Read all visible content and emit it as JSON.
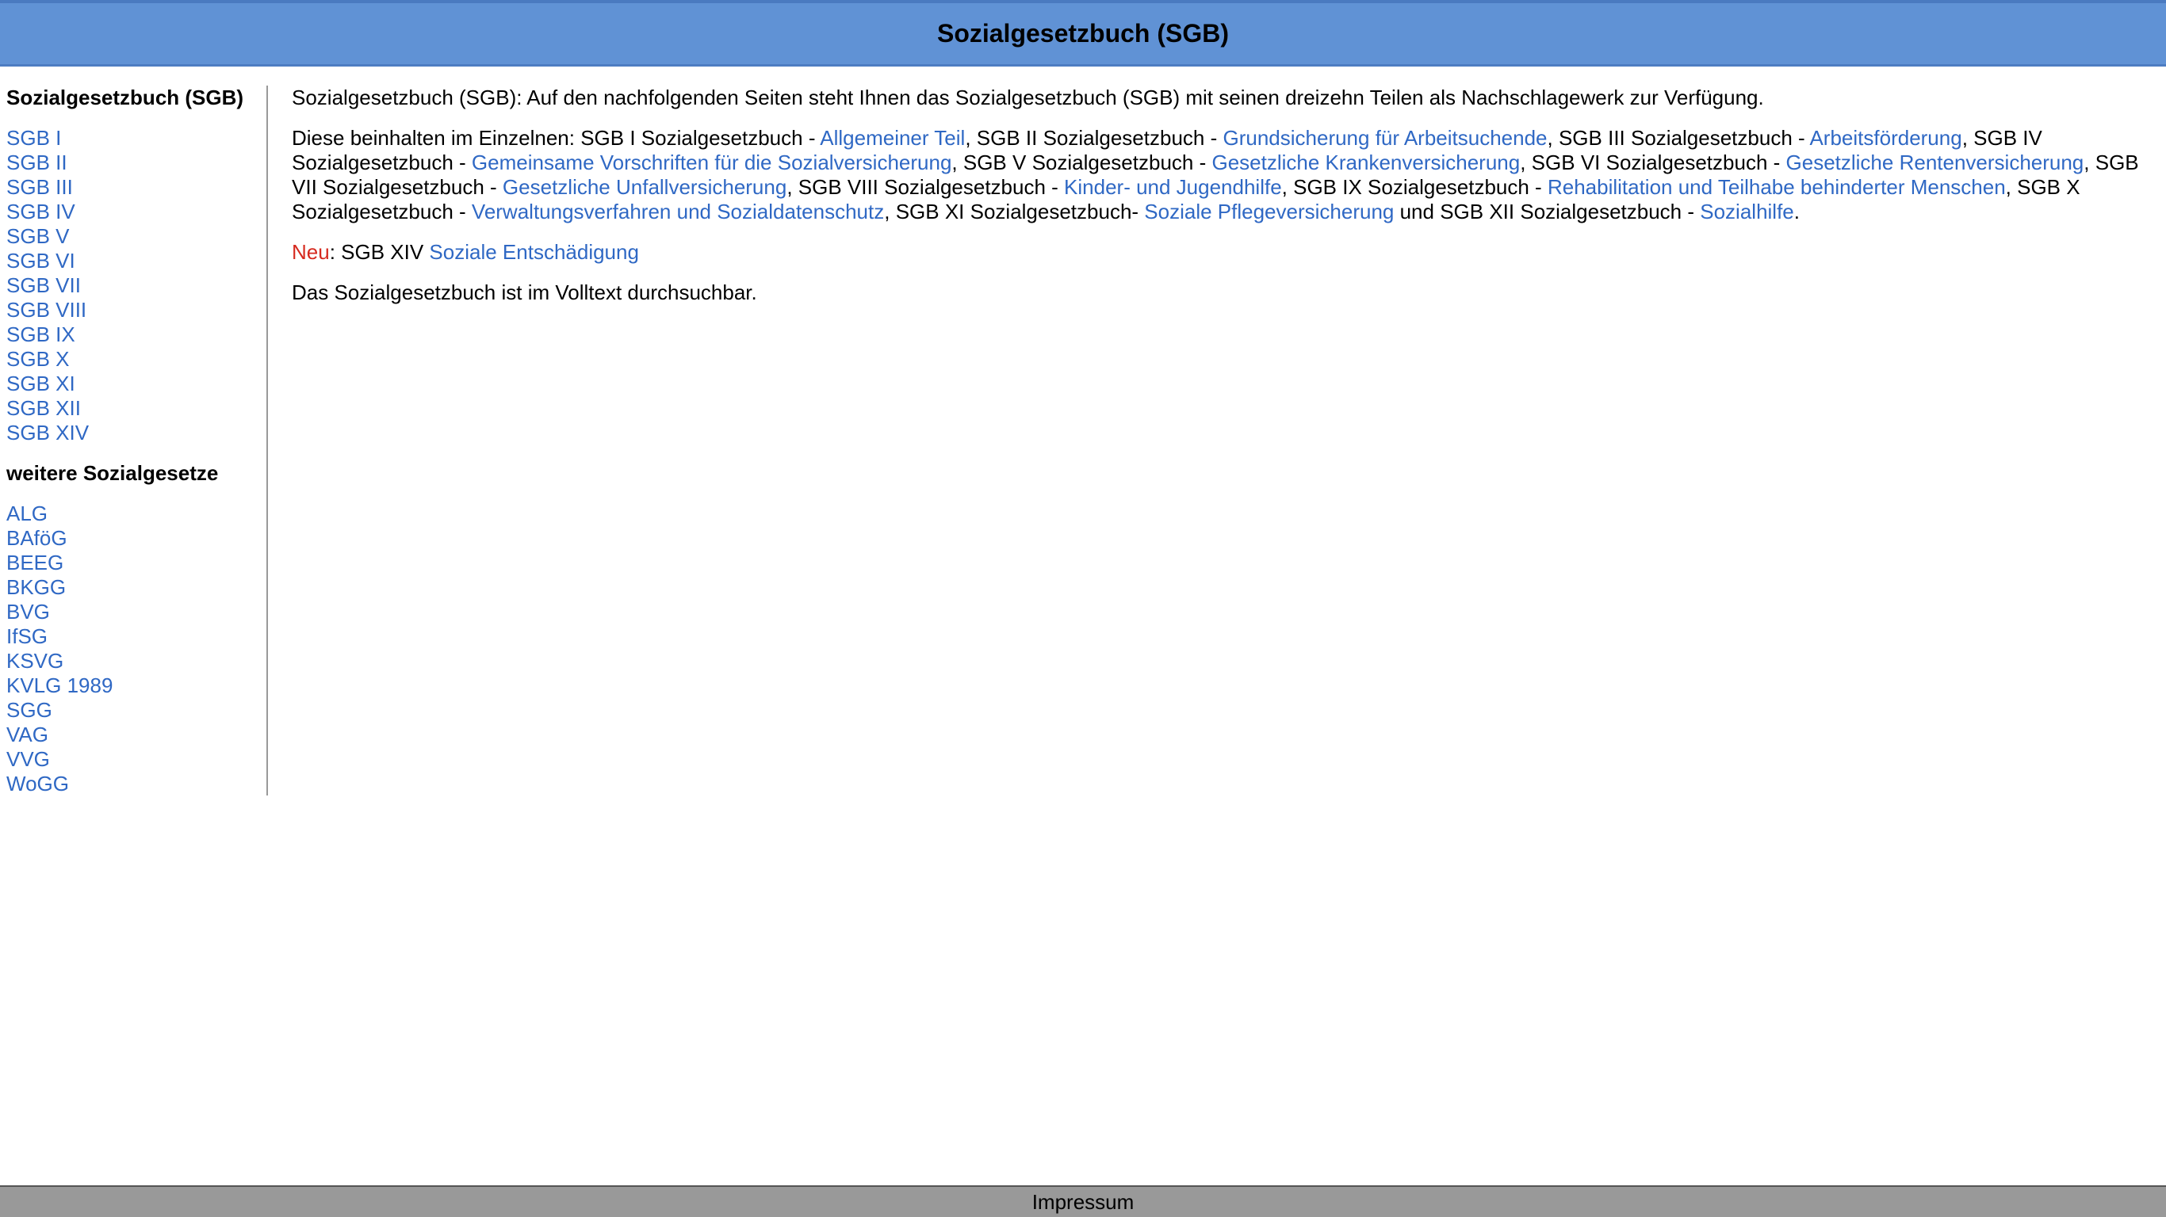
{
  "header": {
    "title": "Sozialgesetzbuch (SGB)"
  },
  "sidebar": {
    "heading_sgb": "Sozialgesetzbuch (SGB)",
    "sgb_links": [
      "SGB I",
      "SGB II",
      "SGB III",
      "SGB IV",
      "SGB V",
      "SGB VI",
      "SGB VII",
      "SGB VIII",
      "SGB IX",
      "SGB X",
      "SGB XI",
      "SGB XII",
      "SGB XIV"
    ],
    "heading_other": "weitere Sozialgesetze",
    "other_links": [
      "ALG",
      "BAföG",
      "BEEG",
      "BKGG",
      "BVG",
      "IfSG",
      "KSVG",
      "KVLG 1989",
      "SGG",
      "VAG",
      "VVG",
      "WoGG"
    ]
  },
  "main": {
    "intro": "Sozialgesetzbuch (SGB): Auf den nachfolgenden Seiten steht Ihnen das Sozialgesetzbuch (SGB) mit seinen dreizehn Teilen als Nachschlagewerk zur Verfügung.",
    "details": {
      "t0": "Diese beinhalten im Einzelnen: SGB I Sozialgesetzbuch - ",
      "l1": "Allgemeiner Teil",
      "t1": ", SGB II Sozialgesetzbuch - ",
      "l2": "Grundsicherung für Arbeitsuchende",
      "t2": ", SGB III Sozialgesetzbuch - ",
      "l3": "Arbeitsförderung",
      "t3": ", SGB IV Sozialgesetzbuch - ",
      "l4": "Gemeinsame Vorschriften für die Sozialversicherung",
      "t4": ", SGB V Sozialgesetzbuch - ",
      "l5": "Gesetzliche Krankenversicherung",
      "t5": ", SGB VI Sozialgesetzbuch - ",
      "l6": "Gesetzliche Rentenversicherung",
      "t6": ", SGB VII Sozialgesetzbuch - ",
      "l7": "Gesetzliche Unfallversicherung",
      "t7": ", SGB VIII Sozialgesetzbuch - ",
      "l8": "Kinder- und Jugendhilfe",
      "t8": ", SGB IX Sozialgesetzbuch - ",
      "l9": "Rehabilitation und Teilhabe behinderter Menschen",
      "t9": ", SGB X Sozialgesetzbuch - ",
      "l10": "Verwaltungsverfahren und Sozialdatenschutz",
      "t10": ", SGB XI Sozialgesetzbuch- ",
      "l11": "Soziale Pflegeversicherung",
      "t11": " und SGB XII Sozialgesetzbuch - ",
      "l12": "Sozialhilfe",
      "t12": "."
    },
    "new_label": "Neu",
    "new_text": ": SGB XIV ",
    "new_link": "Soziale Entschädigung",
    "fulltext": "Das Sozialgesetzbuch ist im Volltext durchsuchbar."
  },
  "footer": {
    "impressum": "Impressum"
  },
  "colors": {
    "header_bg": "#6092d5",
    "link": "#2f68c4",
    "new_label": "#d62a1f",
    "footer_bg": "#999999"
  }
}
